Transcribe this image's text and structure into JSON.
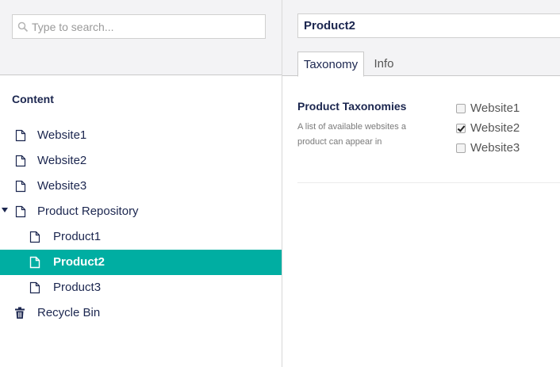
{
  "search": {
    "placeholder": "Type to search..."
  },
  "tree": {
    "section_title": "Content",
    "items": [
      {
        "label": "Website1"
      },
      {
        "label": "Website2"
      },
      {
        "label": "Website3"
      },
      {
        "label": "Product Repository"
      },
      {
        "label": "Product1"
      },
      {
        "label": "Product2"
      },
      {
        "label": "Product3"
      },
      {
        "label": "Recycle Bin"
      }
    ]
  },
  "editor": {
    "name_value": "Product2",
    "tabs": [
      {
        "label": "Taxonomy"
      },
      {
        "label": "Info"
      }
    ],
    "property": {
      "label": "Product Taxonomies",
      "description": "A list of available websites a product can appear in",
      "options": [
        {
          "label": "Website1",
          "checked": false
        },
        {
          "label": "Website2",
          "checked": true
        },
        {
          "label": "Website3",
          "checked": false
        }
      ]
    }
  },
  "colors": {
    "selected": "#00aea2",
    "text": "#1b264f",
    "header_bg": "#f3f3f5"
  }
}
